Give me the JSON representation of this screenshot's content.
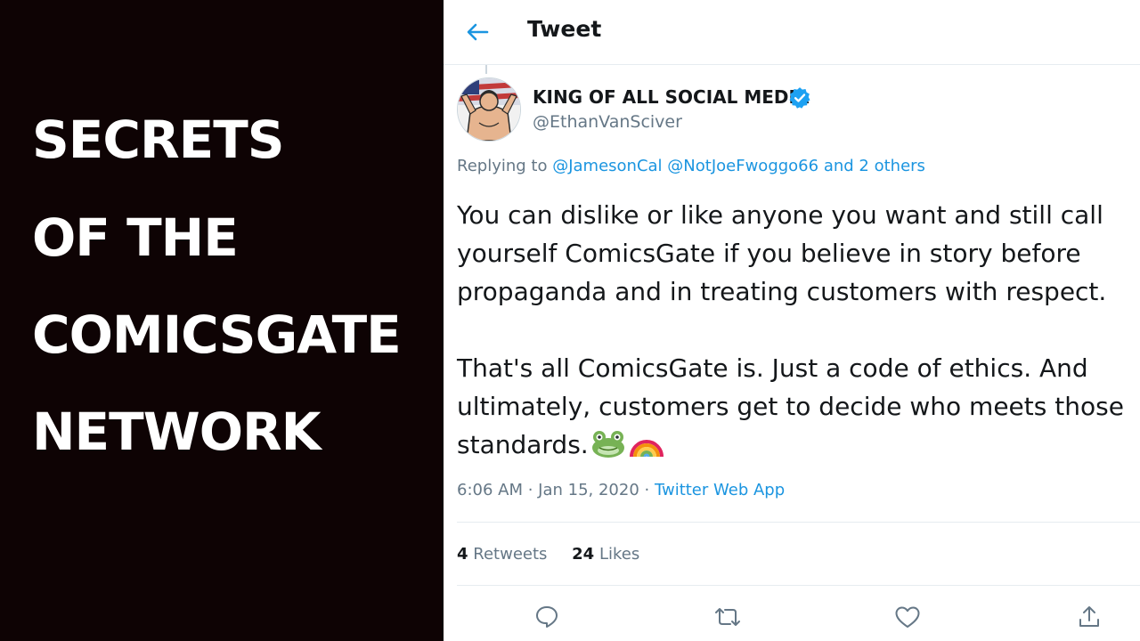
{
  "video_title": {
    "lines": [
      "SECRETS",
      "OF THE",
      "COMICSGATE",
      "NETWORK"
    ]
  },
  "header": {
    "title": "Tweet",
    "back_icon": "arrow-left-icon"
  },
  "tweet": {
    "author": {
      "display_name": "KING OF ALL SOCIAL MEDIA",
      "handle": "@EthanVanSciver",
      "verified": true
    },
    "replying": {
      "prefix": "Replying to ",
      "mentions": [
        "@JamesonCal",
        "@NotJoeFwoggo66"
      ],
      "others": "and 2 others"
    },
    "text": {
      "paragraph1": [
        "You can dislike or like anyone you want and still call",
        "yourself ComicsGate if you believe in story before",
        "propaganda and in treating customers with respect."
      ],
      "paragraph2": [
        "That's all ComicsGate is.  Just a code of ethics.  And",
        "ultimately, customers get to decide who meets those",
        "standards."
      ],
      "emojis": [
        "frog-emoji",
        "rainbow-emoji"
      ]
    },
    "timestamp": "6:06 AM · Jan 15, 2020 · ",
    "source": "Twitter Web App",
    "stats": {
      "retweets_count": "4",
      "retweets_label": "Retweets",
      "likes_count": "24",
      "likes_label": "Likes"
    },
    "actions": [
      "reply-icon",
      "retweet-icon",
      "like-icon",
      "share-icon"
    ]
  },
  "colors": {
    "left_background": "#0e0304",
    "title_text": "#ffffff",
    "twitter_blue": "#1b95e0",
    "secondary_text": "#657786",
    "primary_text": "#14171a",
    "divider": "#e6ecf0"
  }
}
